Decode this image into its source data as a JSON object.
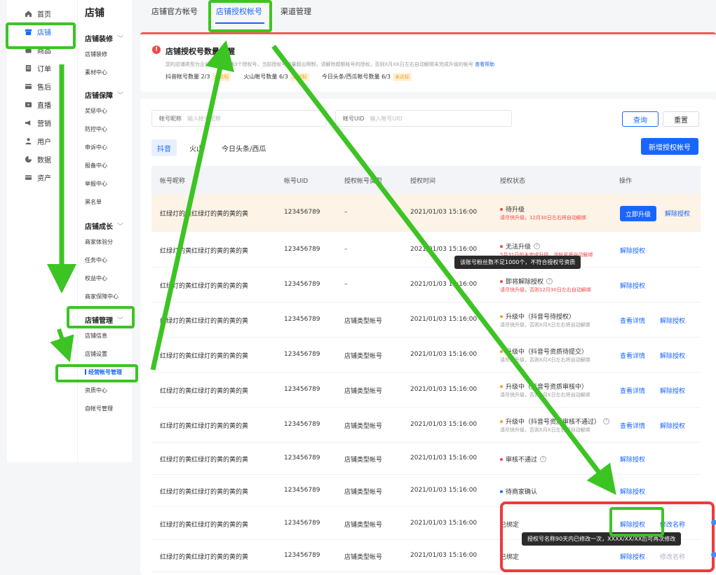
{
  "main_nav": [
    {
      "label": "首页",
      "icon": "home-icon"
    },
    {
      "label": "店铺",
      "icon": "store-icon",
      "active": true
    },
    {
      "label": "商品",
      "icon": "product-icon"
    },
    {
      "label": "订单",
      "icon": "order-icon"
    },
    {
      "label": "售后",
      "icon": "aftersale-icon"
    },
    {
      "label": "直播",
      "icon": "live-icon"
    },
    {
      "label": "营销",
      "icon": "megaphone-icon"
    },
    {
      "label": "用户",
      "icon": "user-icon"
    },
    {
      "label": "数据",
      "icon": "chart-icon"
    },
    {
      "label": "资产",
      "icon": "wallet-icon"
    }
  ],
  "sub_nav": {
    "title": "店铺",
    "sections": [
      {
        "label": "店铺装修",
        "items": [
          "店铺装修",
          "素材中心"
        ]
      },
      {
        "label": "店铺保障",
        "items": [
          "奖惩中心",
          "防控中心",
          "申诉中心",
          "报备中心",
          "举报中心",
          "黑名单"
        ]
      },
      {
        "label": "店铺成长",
        "items": [
          "商家体验分",
          "任务中心",
          "权益中心",
          "商家保障中心"
        ]
      },
      {
        "label": "店铺管理",
        "items": [
          "店铺信息",
          "店铺设置",
          "经营帐号管理",
          "资质中心",
          "自帐号管理"
        ]
      }
    ],
    "active_item": "经营帐号管理"
  },
  "tabs": [
    "店铺官方帐号",
    "店铺授权帐号",
    "渠道管理"
  ],
  "active_tab": "店铺授权帐号",
  "notice": {
    "icon": "!",
    "title": "店铺授权号数量提醒",
    "desc_a": "您的店铺类型为企业店，",
    "desc_b": "可开通3个授权号，当前授权号数量超出限制，请解除超额帐号的授权，否则X月XX日左右自动解绑未完成升级的帐号",
    "help_link": "查看帮助",
    "counts": [
      {
        "label": "抖音帐号数量 2/3",
        "tag": "未达标"
      },
      {
        "label": "火山帐号数量 6/3",
        "tag": "未达标"
      },
      {
        "label": "今日头条/西瓜帐号数量 6/3",
        "tag": "未达标"
      }
    ]
  },
  "filters": {
    "nickname_label": "帐号昵称",
    "nickname_placeholder": "输入帐号昵称",
    "uid_label": "帐号UID",
    "uid_placeholder": "输入帐号UID",
    "query": "查询",
    "reset": "重置"
  },
  "platforms": [
    "抖音",
    "火山",
    "今日头条/西瓜"
  ],
  "new_button": "新增授权帐号",
  "table": {
    "headers": [
      "帐号昵称",
      "帐号UID",
      "授权帐号类型",
      "授权时间",
      "授权状态",
      "操作"
    ],
    "rows": [
      {
        "nickname": "红绿灯的黄红绿灯的黄的黄的黄",
        "uid": "123456789",
        "type": "–",
        "time": "2021/01/03 15:16:00",
        "status": "待升级",
        "dot": "#f04848",
        "help": false,
        "sub": "请尽快升级，12月30日左右将自动解绑",
        "sub_red": true,
        "ops": [
          {
            "label": "立即升级",
            "kind": "primary"
          },
          {
            "label": "解除授权",
            "kind": "link"
          }
        ]
      },
      {
        "nickname": "红绿灯的黄红绿灯的黄的黄的黄",
        "uid": "123456789",
        "type": "–",
        "time": "2021/01/03 15:16:00",
        "status": "无法升级",
        "dot": "#f04848",
        "help": true,
        "sub": "5月31日前未完成升级，该帐号将自动解绑",
        "sub_red": true,
        "ops": [
          {
            "label": "解除授权",
            "kind": "link"
          }
        ]
      },
      {
        "nickname": "红绿灯的黄红绿灯的黄的黄的黄",
        "uid": "123456789",
        "type": "–",
        "time": "2021/01/03 15:16:00",
        "status": "即将解除授权",
        "dot": "#f04848",
        "help": true,
        "sub": "请尽快升级，否则12月30日左右自动解绑",
        "sub_red": true,
        "ops": [
          {
            "label": "解除授权",
            "kind": "link"
          }
        ]
      },
      {
        "nickname": "红绿灯的黄红绿灯的黄的黄的黄",
        "uid": "123456789",
        "type": "店铺类型帐号",
        "time": "2021/01/03 15:16:00",
        "status": "升级中（抖音号待授权）",
        "dot": "#f0a020",
        "help": false,
        "sub": "请尽快升级，否则X月X日左右将自动解绑",
        "sub_red": false,
        "ops": [
          {
            "label": "查看详情",
            "kind": "link"
          },
          {
            "label": "解除授权",
            "kind": "link"
          }
        ]
      },
      {
        "nickname": "红绿灯的黄红绿灯的黄的黄的黄",
        "uid": "123456789",
        "type": "店铺类型帐号",
        "time": "2021/01/03 15:16:00",
        "status": "升级中（抖音号资质待提交）",
        "dot": "#f0a020",
        "help": false,
        "sub": "请尽快升级，否则X月X日左右将自动解绑",
        "sub_red": false,
        "ops": [
          {
            "label": "查看详情",
            "kind": "link"
          },
          {
            "label": "解除授权",
            "kind": "link"
          }
        ]
      },
      {
        "nickname": "红绿灯的黄红绿灯的黄的黄的黄",
        "uid": "123456789",
        "type": "店铺类型帐号",
        "time": "2021/01/03 15:16:00",
        "status": "升级中（抖音号资质审核中）",
        "dot": "#f0a020",
        "help": false,
        "sub": "请尽快升级，否则X月X日左右将自动解绑",
        "sub_red": false,
        "ops": [
          {
            "label": "查看详情",
            "kind": "link"
          },
          {
            "label": "解除授权",
            "kind": "link"
          }
        ]
      },
      {
        "nickname": "红绿灯的黄红绿灯的黄的黄的黄",
        "uid": "123456789",
        "type": "店铺类型帐号",
        "time": "2021/01/03 15:16:00",
        "status": "升级中（抖音号资质审核不通过）",
        "dot": "#f0a020",
        "help": true,
        "sub": "请尽快升级，否则X月X日左右将自动解绑",
        "sub_red": false,
        "ops": [
          {
            "label": "查看详情",
            "kind": "link"
          },
          {
            "label": "解除授权",
            "kind": "link"
          }
        ]
      },
      {
        "nickname": "红绿灯的黄红绿灯的黄的黄的黄",
        "uid": "123456789",
        "type": "店铺类型帐号",
        "time": "2021/01/03 15:16:00",
        "status": "审核不通过",
        "dot": "#f04848",
        "help": true,
        "sub": "",
        "sub_red": false,
        "ops": [
          {
            "label": "解除授权",
            "kind": "link"
          }
        ]
      },
      {
        "nickname": "红绿灯的黄红绿灯的黄的黄的黄",
        "uid": "123456789",
        "type": "店铺类型帐号",
        "time": "2021/01/03 15:16:00",
        "status": "待商家确认",
        "dot": "#1966ff",
        "help": false,
        "sub": "",
        "sub_red": false,
        "ops": [
          {
            "label": "解除授权",
            "kind": "link"
          }
        ]
      },
      {
        "nickname": "红绿灯的黄红绿灯的黄的黄的黄",
        "uid": "123456789",
        "type": "店铺类型帐号",
        "time": "2021/01/03 15:16:00",
        "status": "已绑定",
        "dot": "",
        "help": false,
        "sub": "",
        "sub_red": false,
        "ops": [
          {
            "label": "解除授权",
            "kind": "link"
          },
          {
            "label": "修改名称",
            "kind": "link"
          }
        ]
      },
      {
        "nickname": "红绿灯的黄红绿灯的黄的黄的黄",
        "uid": "123456789",
        "type": "店铺类型帐号",
        "time": "2021/01/03 15:16:00",
        "status": "已绑定",
        "dot": "",
        "help": false,
        "sub": "",
        "sub_red": false,
        "ops": [
          {
            "label": "解除授权",
            "kind": "link"
          },
          {
            "label": "修改名称",
            "kind": "disabled"
          }
        ]
      }
    ]
  },
  "tooltips": {
    "fans": "该账号粉丝数不足1000个，不符合授权号资质",
    "rename": "授权号名称90天内已修改一次，XXXX/XX/XX后可再次修改"
  },
  "colors": {
    "primary": "#1966ff",
    "danger": "#f04848",
    "warning": "#f0a020",
    "annotation_green": "#3cc423",
    "annotation_red": "#ee3b3b"
  }
}
